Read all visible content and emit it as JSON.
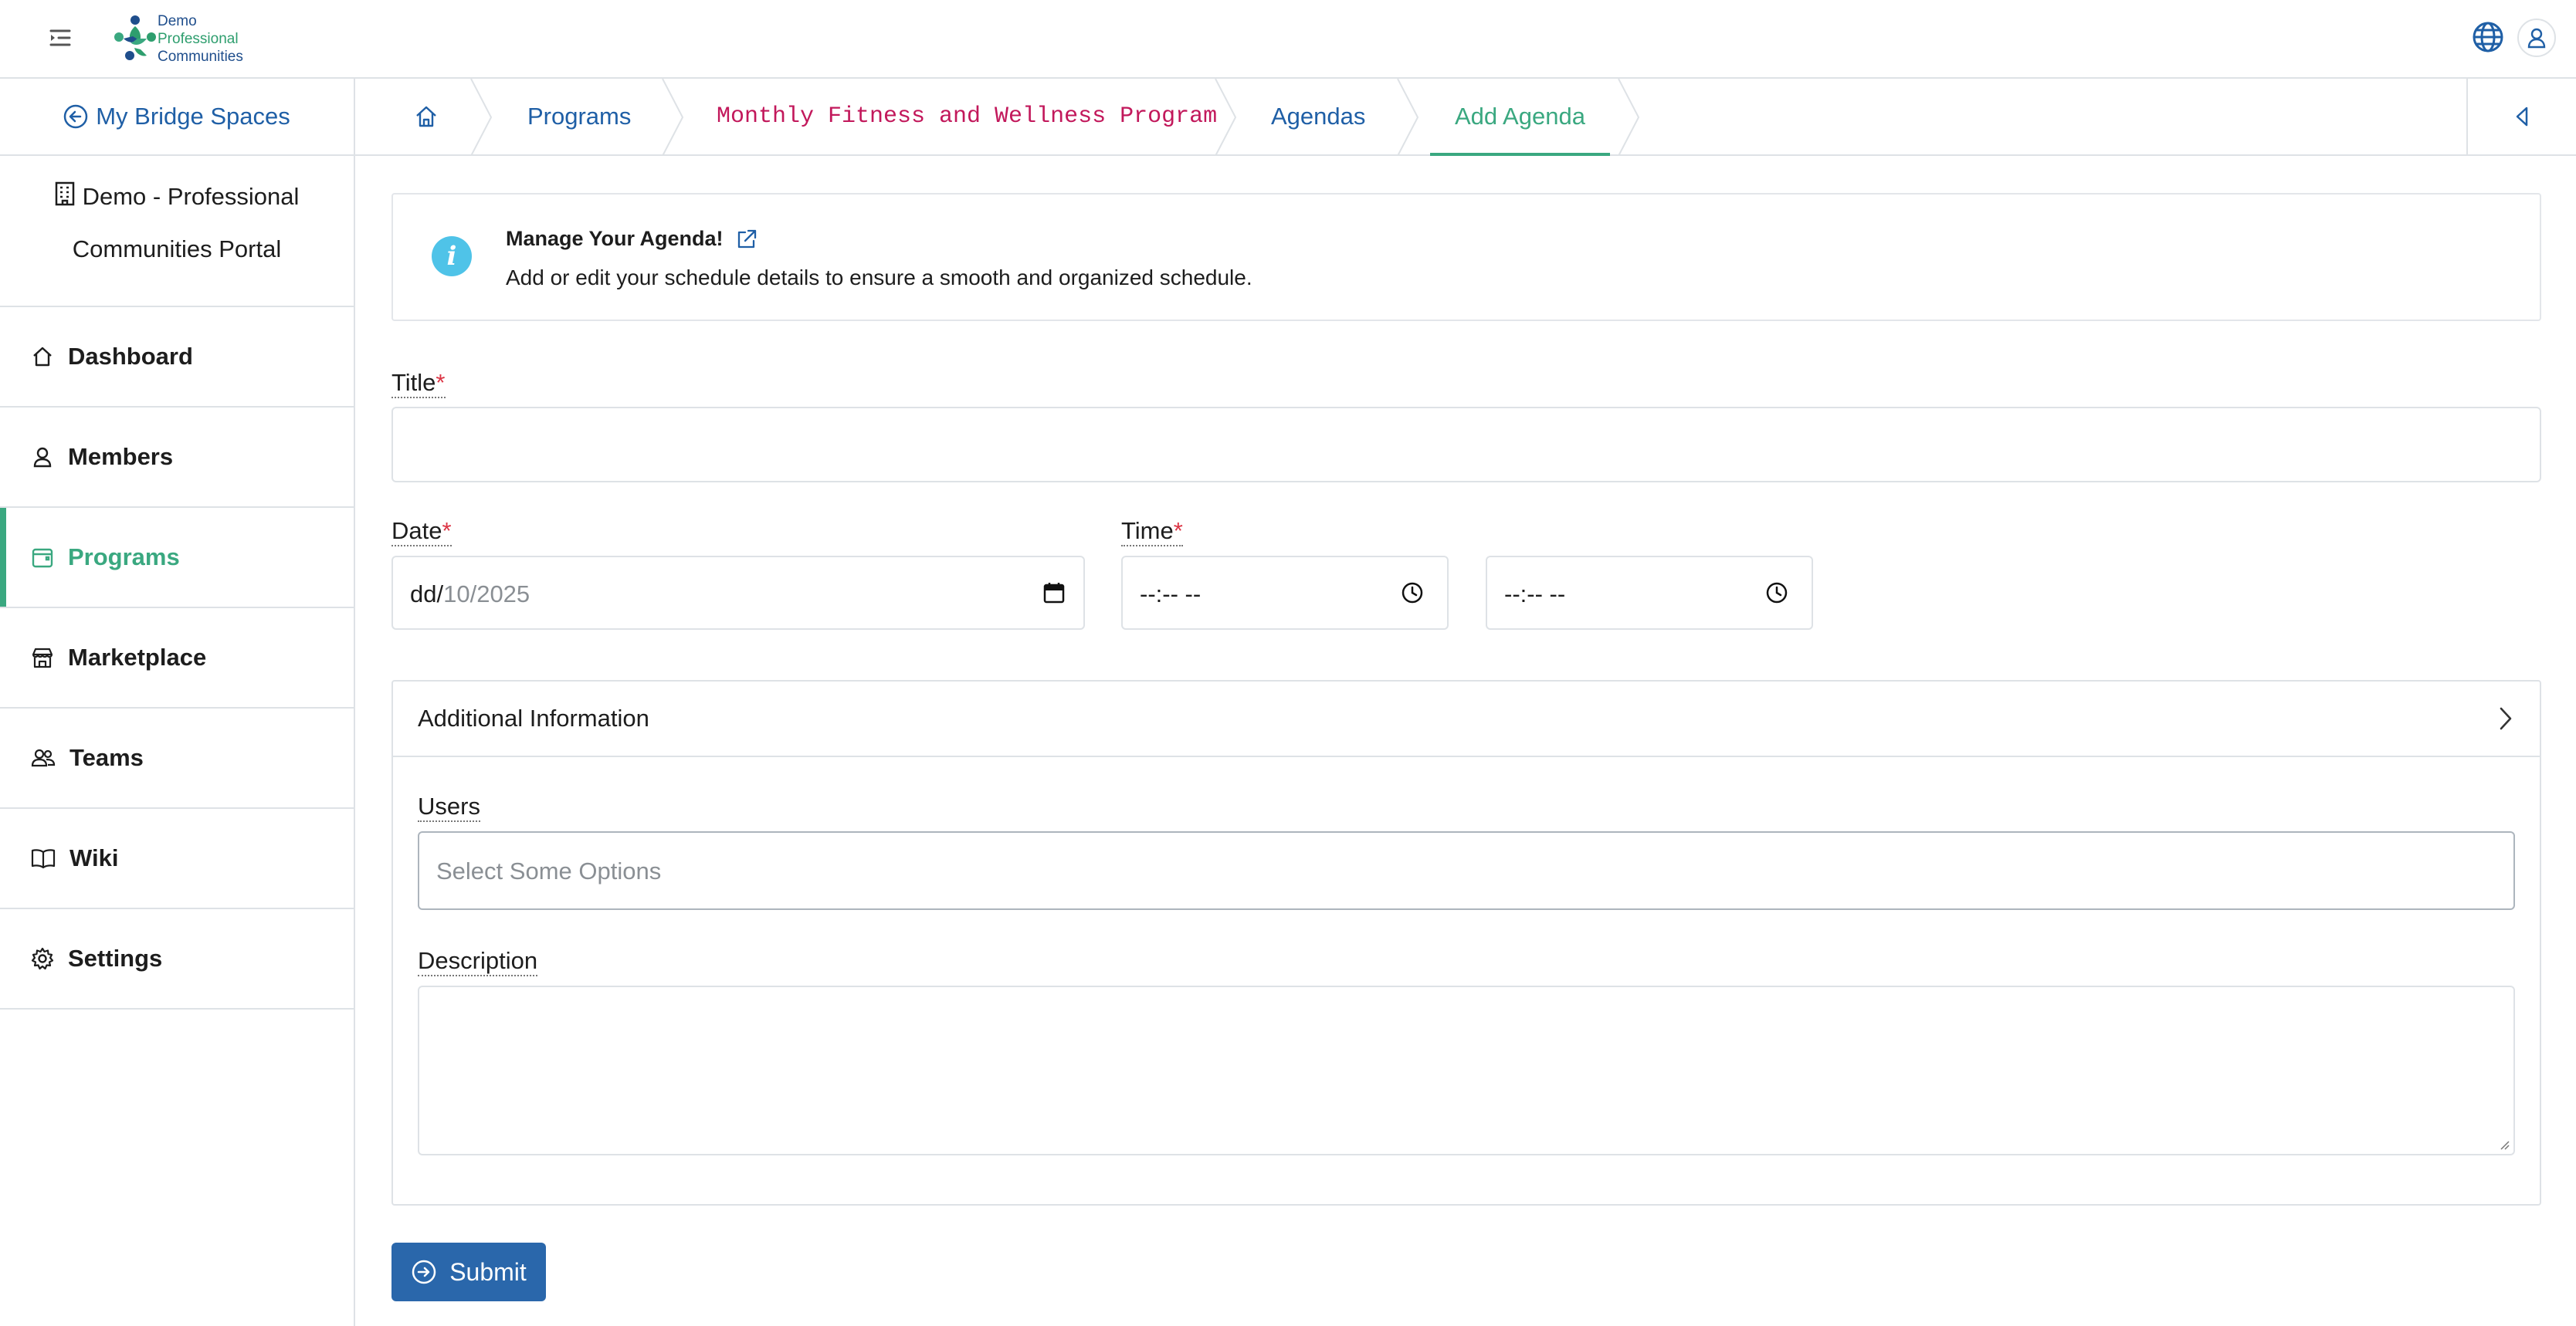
{
  "header": {
    "logo_lines": [
      "Demo",
      "Professional",
      "Communities"
    ],
    "menu_icon": "menu-collapse-icon",
    "language_icon": "globe-icon",
    "user_icon": "user-icon"
  },
  "sidebar": {
    "back_label": "My Bridge Spaces",
    "org_name_line1": "Demo - Professional",
    "org_name_line2": "Communities Portal",
    "items": [
      {
        "label": "Dashboard",
        "icon": "home-icon",
        "active": false
      },
      {
        "label": "Members",
        "icon": "user-icon",
        "active": false
      },
      {
        "label": "Programs",
        "icon": "calendar-icon",
        "active": true
      },
      {
        "label": "Marketplace",
        "icon": "store-icon",
        "active": false
      },
      {
        "label": "Teams",
        "icon": "people-icon",
        "active": false
      },
      {
        "label": "Wiki",
        "icon": "book-icon",
        "active": false
      },
      {
        "label": "Settings",
        "icon": "gear-icon",
        "active": false
      }
    ]
  },
  "breadcrumb": {
    "home_icon": "home-icon",
    "items": [
      "Programs",
      "Monthly Fitness and Wellness Program",
      "Agendas",
      "Add Agenda"
    ],
    "current": "Add Agenda"
  },
  "info": {
    "title": "Manage Your Agenda!",
    "text": "Add or edit your schedule details to ensure a smooth and organized schedule."
  },
  "form": {
    "title_label": "Title",
    "title_value": "",
    "required_mark": "*",
    "date_label": "Date",
    "date_value_prefix": "dd/",
    "date_value_rest": "10/2025",
    "time_label": "Time",
    "time_start": "--:-- --",
    "time_end": "--:-- --",
    "additional_label": "Additional Information",
    "users_label": "Users",
    "users_placeholder": "Select Some Options",
    "description_label": "Description",
    "description_value": "",
    "submit_label": "Submit"
  },
  "colors": {
    "primary": "#2a67ab",
    "accent": "#3aa880",
    "link": "#1f5fa6",
    "breadcrumb_code": "#c2185b",
    "info": "#4fc3e8",
    "required": "#dc3545"
  }
}
